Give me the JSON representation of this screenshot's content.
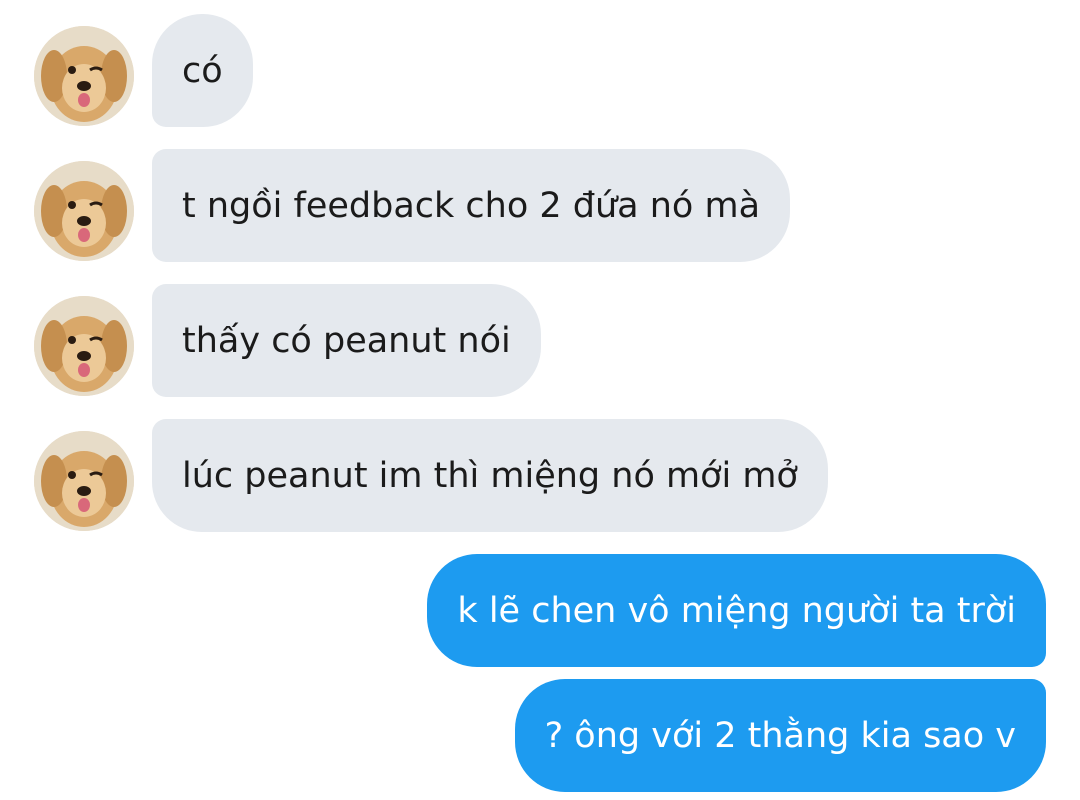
{
  "conversation": {
    "messages": [
      {
        "sender": "them",
        "text": "có"
      },
      {
        "sender": "them",
        "text": "t ngồi feedback cho 2 đứa nó mà"
      },
      {
        "sender": "them",
        "text": "thấy có peanut nói"
      },
      {
        "sender": "them",
        "text": "lúc peanut im thì miệng nó mới mở"
      },
      {
        "sender": "me",
        "text": "k lẽ chen vô miệng người ta trời"
      },
      {
        "sender": "me",
        "text": "? ông với 2 thằng kia sao v"
      }
    ]
  },
  "colors": {
    "incoming_bubble": "#e5e9ee",
    "outgoing_bubble": "#1d9bf0",
    "incoming_text": "#1b1b1b",
    "outgoing_text": "#ffffff"
  },
  "icons": {
    "avatar": "golden-retriever-avatar-icon"
  }
}
